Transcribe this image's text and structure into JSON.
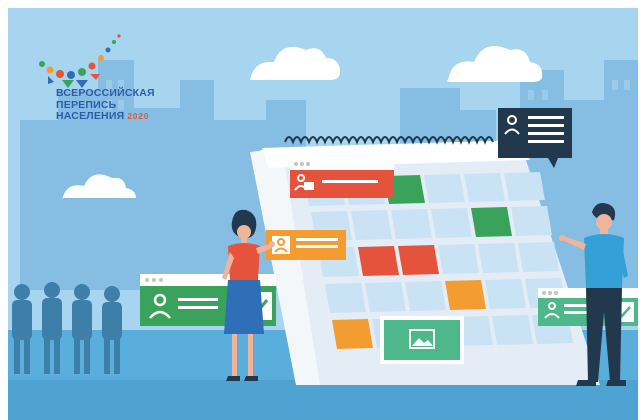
{
  "logo": {
    "line1": "ВСЕРОССИЙСКАЯ",
    "line2": "ПЕРЕПИСЬ",
    "line3": "НАСЕЛЕНИЯ",
    "year": "2020"
  },
  "colors": {
    "sky": "#a7d4ef",
    "city": "#7fb6dc",
    "ground": "#56acd7",
    "red": "#e5533d",
    "green": "#3aa35b",
    "orange": "#f39c32",
    "teal": "#4fb88b",
    "navy": "#21384d"
  }
}
